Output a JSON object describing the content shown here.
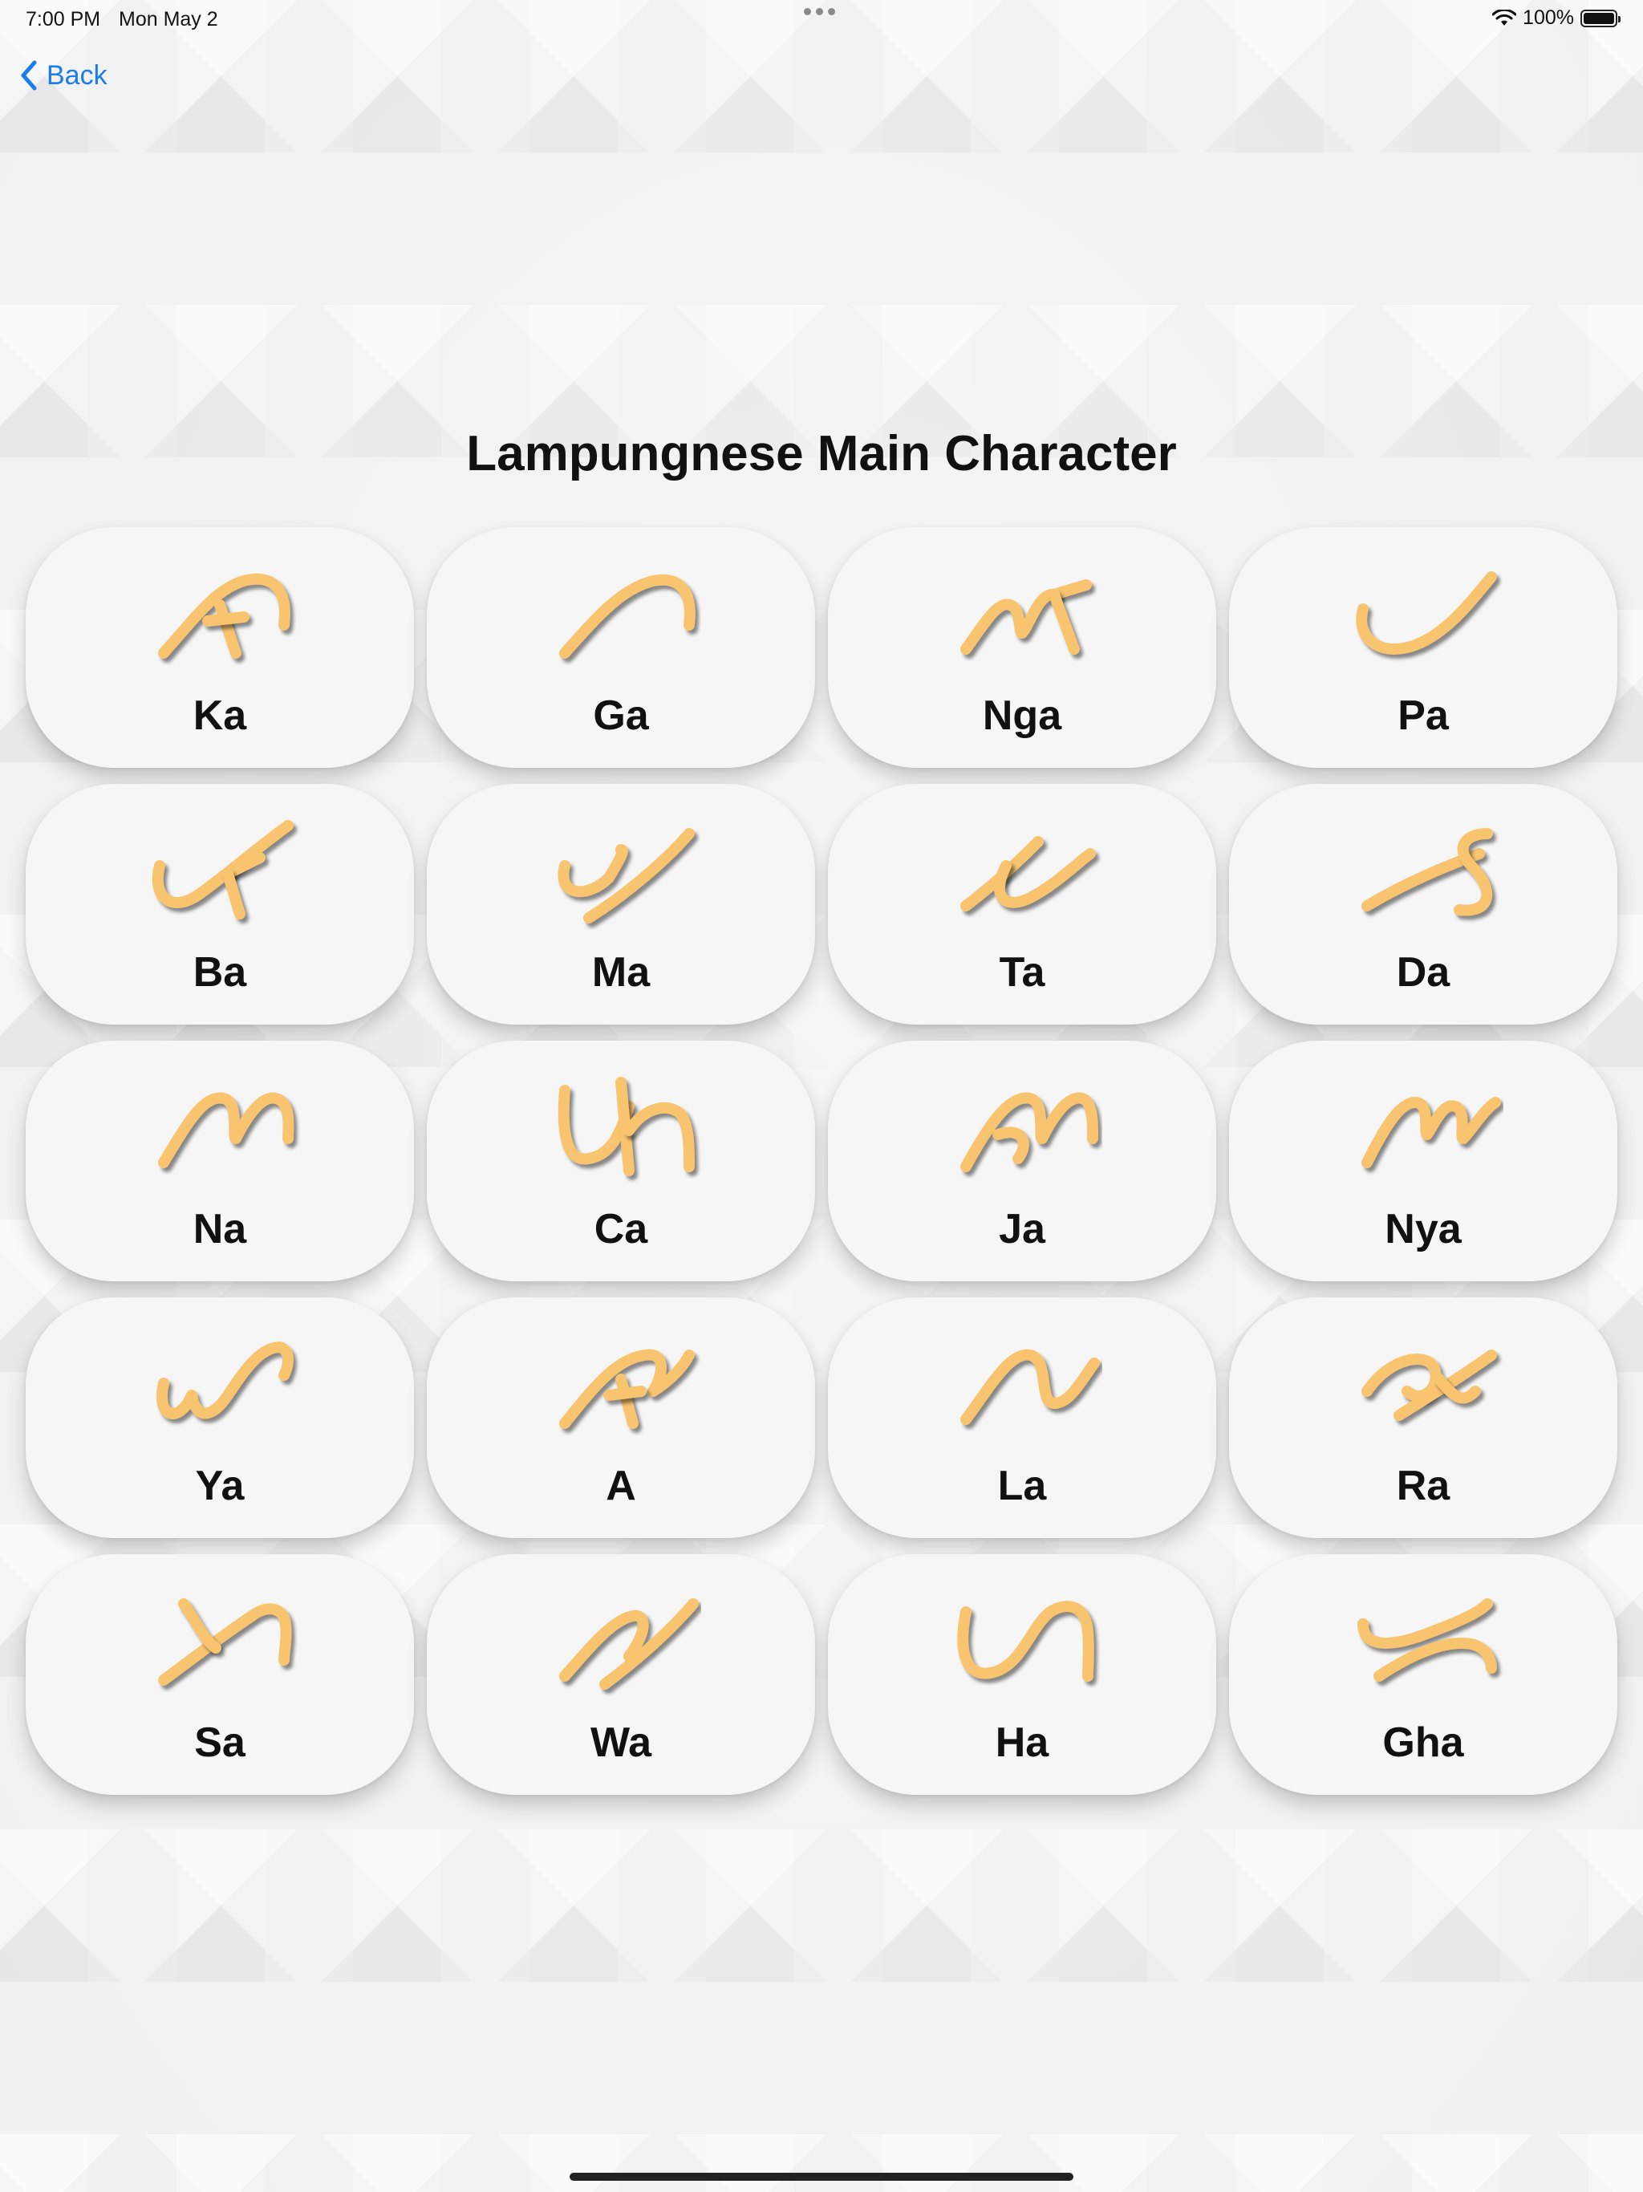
{
  "status_bar": {
    "time": "7:00 PM",
    "date": "Mon May 2",
    "battery": "100%"
  },
  "nav": {
    "back_label": "Back"
  },
  "title": "Lampungnese Main Character",
  "colors": {
    "accent": "#1a7cf0",
    "glyph": "#f9c46f",
    "card": "#f6f6f6"
  },
  "characters": [
    {
      "label": "Ka",
      "icon": "lampung-ka-glyph"
    },
    {
      "label": "Ga",
      "icon": "lampung-ga-glyph"
    },
    {
      "label": "Nga",
      "icon": "lampung-nga-glyph"
    },
    {
      "label": "Pa",
      "icon": "lampung-pa-glyph"
    },
    {
      "label": "Ba",
      "icon": "lampung-ba-glyph"
    },
    {
      "label": "Ma",
      "icon": "lampung-ma-glyph"
    },
    {
      "label": "Ta",
      "icon": "lampung-ta-glyph"
    },
    {
      "label": "Da",
      "icon": "lampung-da-glyph"
    },
    {
      "label": "Na",
      "icon": "lampung-na-glyph"
    },
    {
      "label": "Ca",
      "icon": "lampung-ca-glyph"
    },
    {
      "label": "Ja",
      "icon": "lampung-ja-glyph"
    },
    {
      "label": "Nya",
      "icon": "lampung-nya-glyph"
    },
    {
      "label": "Ya",
      "icon": "lampung-ya-glyph"
    },
    {
      "label": "A",
      "icon": "lampung-a-glyph"
    },
    {
      "label": "La",
      "icon": "lampung-la-glyph"
    },
    {
      "label": "Ra",
      "icon": "lampung-ra-glyph"
    },
    {
      "label": "Sa",
      "icon": "lampung-sa-glyph"
    },
    {
      "label": "Wa",
      "icon": "lampung-wa-glyph"
    },
    {
      "label": "Ha",
      "icon": "lampung-ha-glyph"
    },
    {
      "label": "Gha",
      "icon": "lampung-gha-glyph"
    }
  ]
}
